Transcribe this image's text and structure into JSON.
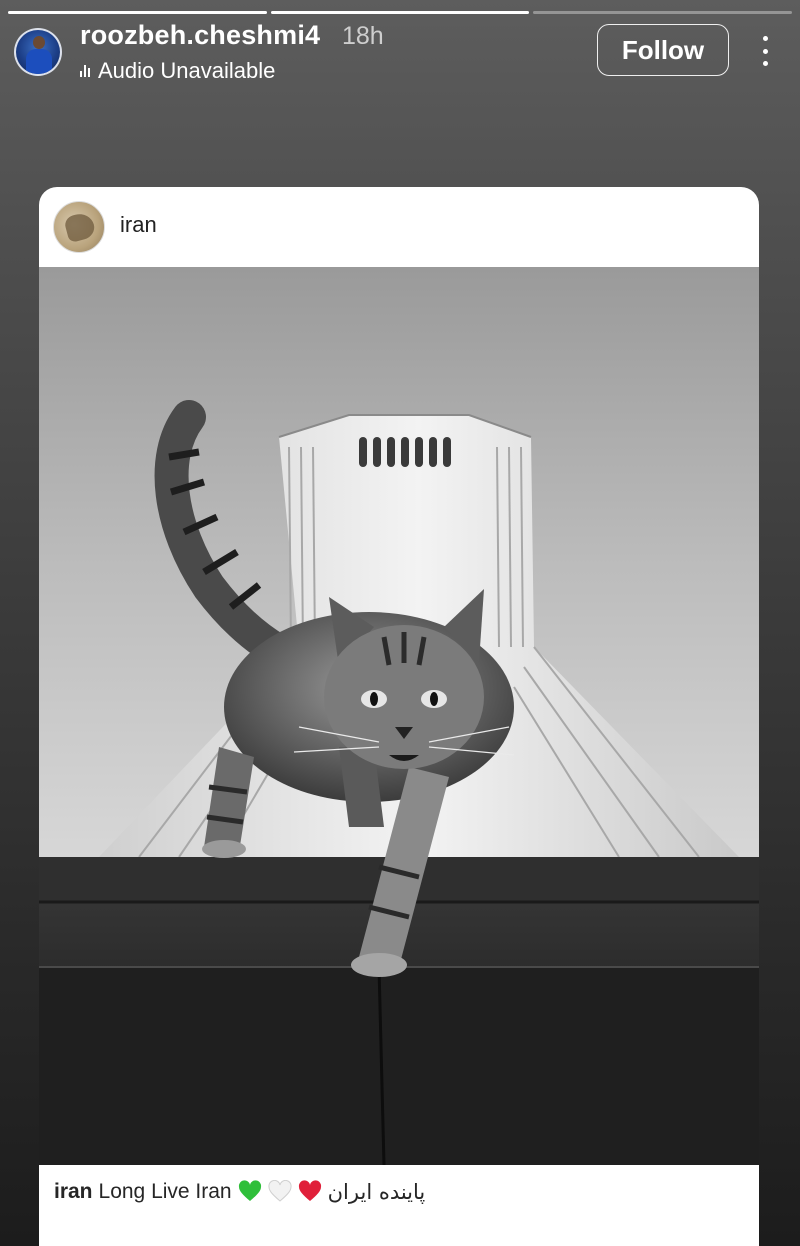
{
  "progress": [
    {
      "fill": 1.0
    },
    {
      "fill": 1.0
    },
    {
      "fill": 0.0
    }
  ],
  "header": {
    "username": "roozbeh.cheshmi4",
    "time": "18h",
    "audio_status": "Audio Unavailable",
    "follow_label": "Follow",
    "more_icon": "more-vertical-icon"
  },
  "post": {
    "username": "iran",
    "image_description_icon": "photo",
    "caption": {
      "user": "iran",
      "text": "Long Live Iran",
      "hearts": [
        "green-heart",
        "white-heart",
        "red-heart"
      ],
      "persian_text": "پاینده ایران"
    }
  },
  "colors": {
    "green_heart": "#2fbf3a",
    "white_heart": "#f2f2f2",
    "red_heart": "#e0203a"
  }
}
